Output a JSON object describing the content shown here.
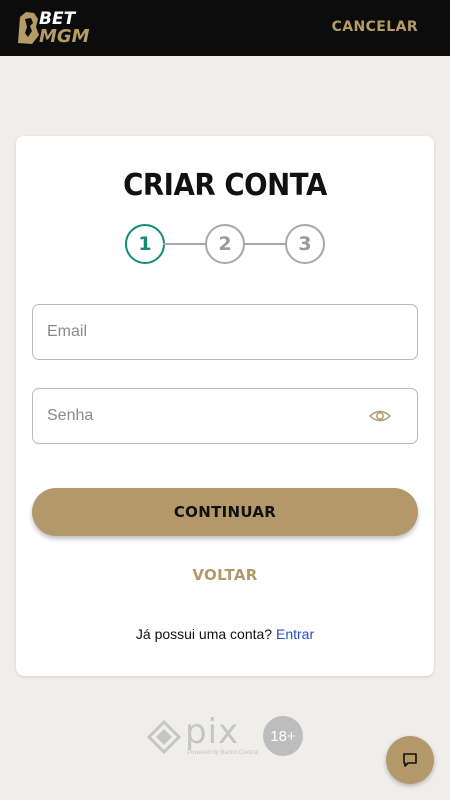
{
  "header": {
    "logo_line1": "BET",
    "logo_line2": "MGM",
    "cancel_label": "CANCELAR",
    "logo_icon": "lion-icon"
  },
  "form": {
    "title": "CRIAR CONTA",
    "steps": [
      "1",
      "2",
      "3"
    ],
    "active_step": 1,
    "email_placeholder": "Email",
    "email_value": "",
    "password_placeholder": "Senha",
    "password_value": "",
    "password_toggle_icon": "eye-icon",
    "continue_label": "CONTINUAR",
    "back_label": "VOLTAR",
    "login_prompt": "Já possui uma conta?",
    "login_link": "Entrar"
  },
  "footer": {
    "pix_label": "pix",
    "pix_tagline": "Powered by Banco Central",
    "age_badge": "18+",
    "chat_icon": "chat-icon"
  },
  "colors": {
    "brand_gold": "#b3996a",
    "header_bg": "#0c0c0c",
    "page_bg": "#efeeea",
    "active_step": "#148c76",
    "link": "#2a4dbd"
  }
}
